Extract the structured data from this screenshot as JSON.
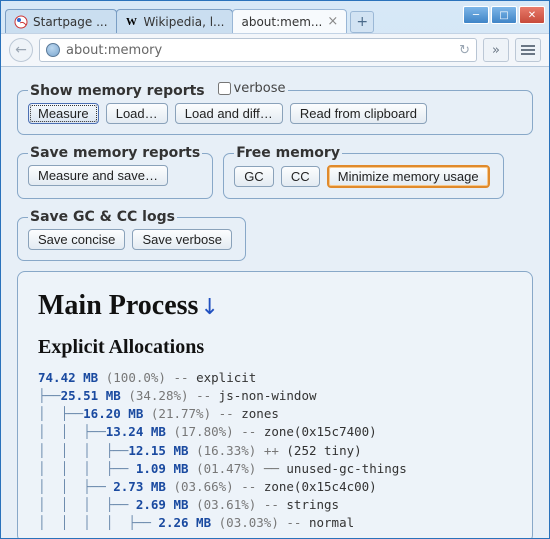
{
  "window": {
    "tabs": [
      {
        "label": "Startpage ...",
        "fav": "sp"
      },
      {
        "label": "Wikipedia, l...",
        "fav": "wk"
      },
      {
        "label": "about:mem...",
        "fav": "",
        "active": true
      }
    ],
    "newtab": "+",
    "controls": {
      "min": "—",
      "max": "❐",
      "close": "X"
    }
  },
  "nav": {
    "back": "←",
    "url": "about:memory",
    "reload": "↻",
    "more": "»"
  },
  "panels": {
    "show": {
      "title": "Show memory reports",
      "verbose_label": "verbose",
      "measure": "Measure",
      "load": "Load…",
      "load_diff": "Load and diff…",
      "read_clip": "Read from clipboard"
    },
    "save": {
      "title": "Save memory reports",
      "measure_save": "Measure and save…"
    },
    "free": {
      "title": "Free memory",
      "gc": "GC",
      "cc": "CC",
      "minimize": "Minimize memory usage"
    },
    "logs": {
      "title": "Save GC & CC logs",
      "concise": "Save concise",
      "verbose": "Save verbose"
    }
  },
  "report": {
    "title": "Main Process",
    "anchor": "↓",
    "section": "Explicit Allocations",
    "rows": [
      {
        "indent": 0,
        "size": "74.42 MB",
        "pct": "(100.0%)",
        "sep": "--",
        "name": "explicit"
      },
      {
        "indent": 1,
        "size": "25.51 MB",
        "pct": "(34.28%)",
        "sep": "--",
        "name": "js-non-window"
      },
      {
        "indent": 2,
        "size": "16.20 MB",
        "pct": "(21.77%)",
        "sep": "--",
        "name": "zones"
      },
      {
        "indent": 3,
        "size": "13.24 MB",
        "pct": "(17.80%)",
        "sep": "--",
        "name": "zone(0x15c7400)"
      },
      {
        "indent": 4,
        "size": "12.15 MB",
        "pct": "(16.33%)",
        "sep": "++",
        "name": "(252 tiny)"
      },
      {
        "indent": 4,
        "size": "1.09 MB",
        "pct": "(01.47%)",
        "sep": "──",
        "name": "unused-gc-things"
      },
      {
        "indent": 3,
        "size": "2.73 MB",
        "pct": "(03.66%)",
        "sep": "--",
        "name": "zone(0x15c4c00)"
      },
      {
        "indent": 4,
        "size": "2.69 MB",
        "pct": "(03.61%)",
        "sep": "--",
        "name": "strings"
      },
      {
        "indent": 5,
        "size": "2.26 MB",
        "pct": "(03.03%)",
        "sep": "--",
        "name": "normal"
      }
    ]
  }
}
